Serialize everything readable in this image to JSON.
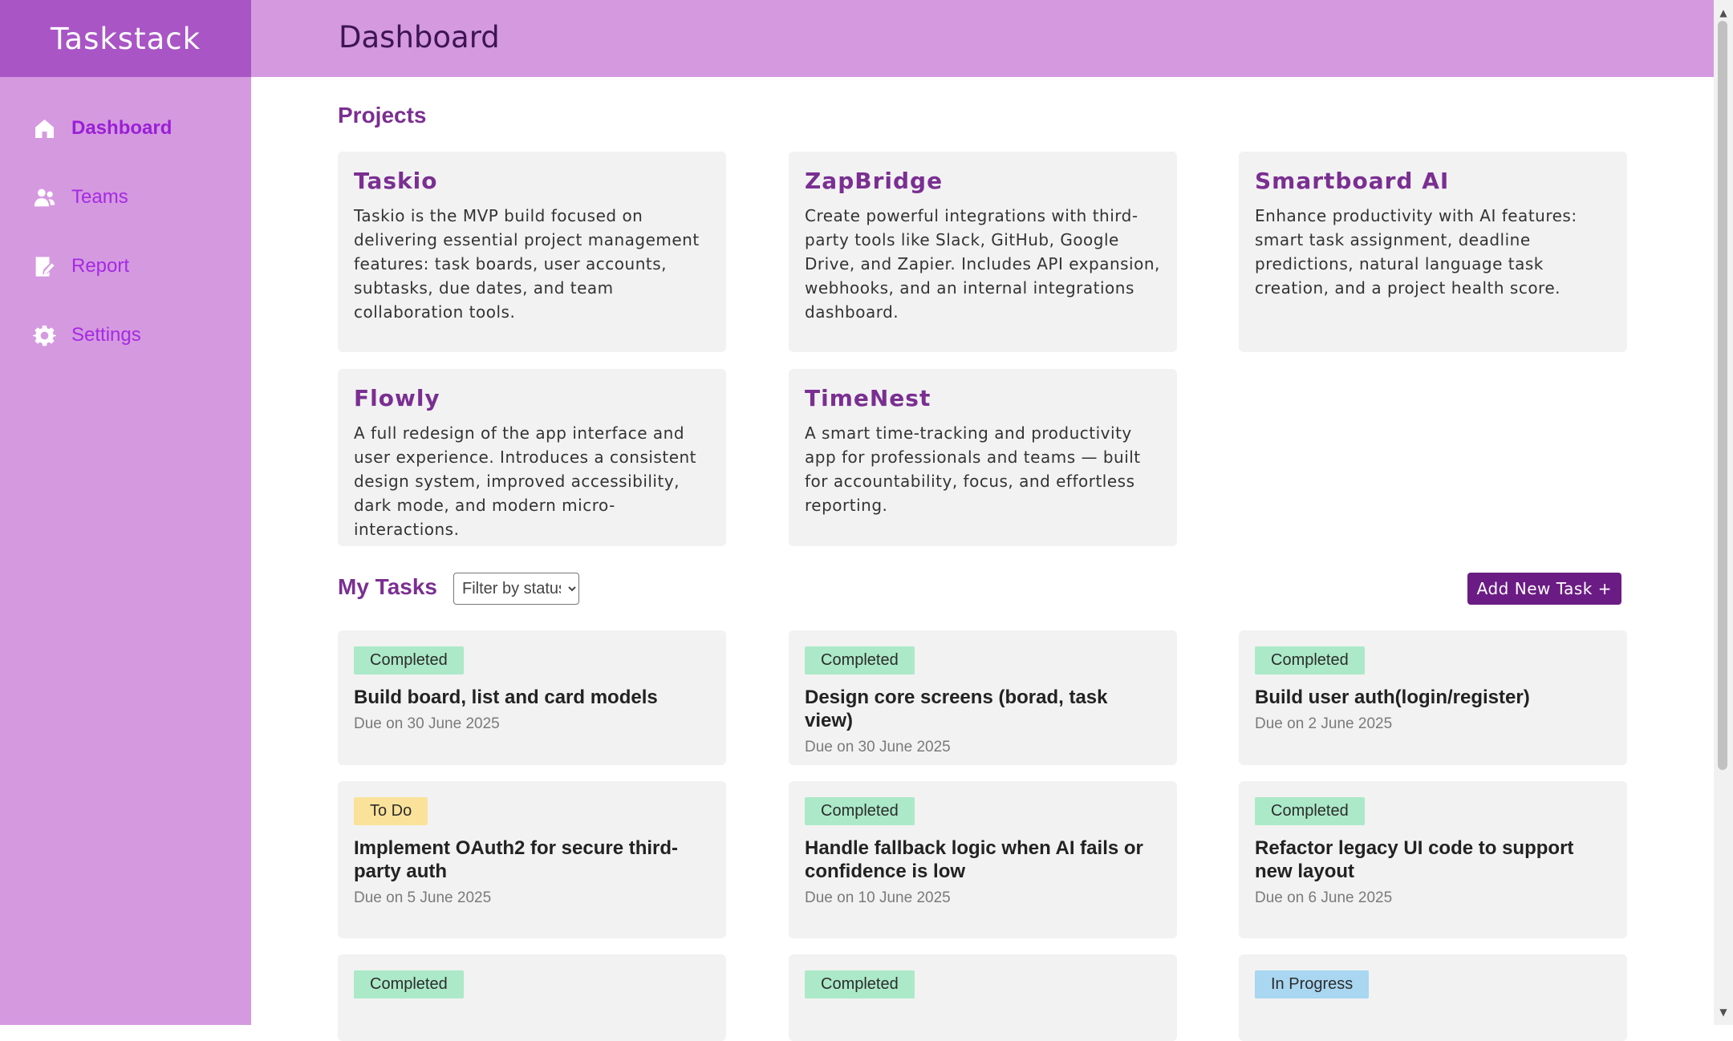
{
  "app": {
    "name": "Taskstack"
  },
  "sidebar": {
    "items": [
      {
        "label": "Dashboard",
        "icon": "home-icon"
      },
      {
        "label": "Teams",
        "icon": "users-icon"
      },
      {
        "label": "Report",
        "icon": "report-icon"
      },
      {
        "label": "Settings",
        "icon": "gear-icon"
      }
    ]
  },
  "header": {
    "title": "Dashboard"
  },
  "projects": {
    "title": "Projects",
    "items": [
      {
        "name": "Taskio",
        "description": "Taskio is the MVP build focused on delivering essential project management features: task boards, user accounts, subtasks, due dates, and team collaboration tools."
      },
      {
        "name": "ZapBridge",
        "description": "Create powerful integrations with third-party tools like Slack, GitHub, Google Drive, and Zapier. Includes API expansion, webhooks, and an internal integrations dashboard."
      },
      {
        "name": "Smartboard AI",
        "description": "Enhance productivity with AI features: smart task assignment, deadline predictions, natural language task creation, and a project health score."
      },
      {
        "name": "Flowly",
        "description": "A full redesign of the app interface and user experience. Introduces a consistent design system, improved accessibility, dark mode, and modern micro-interactions."
      },
      {
        "name": "TimeNest",
        "description": "A smart time-tracking and productivity app for professionals and teams — built for accountability, focus, and effortless reporting."
      }
    ]
  },
  "tasks": {
    "title": "My Tasks",
    "filter_value": "Filter by status",
    "add_button_label": "Add New Task +",
    "items": [
      {
        "status": "Completed",
        "title": "Build board, list and card models",
        "due": "Due on 30 June 2025"
      },
      {
        "status": "Completed",
        "title": "Design core screens (borad, task view)",
        "due": "Due on 30 June 2025"
      },
      {
        "status": "Completed",
        "title": "Build user auth(login/register)",
        "due": "Due on 2 June 2025"
      },
      {
        "status": "To Do",
        "title": "Implement OAuth2 for secure third-party auth",
        "due": "Due on 5 June 2025"
      },
      {
        "status": "Completed",
        "title": "Handle fallback logic when AI fails or confidence is low",
        "due": "Due on 10 June 2025"
      },
      {
        "status": "Completed",
        "title": "Refactor legacy UI code to support new layout",
        "due": "Due on 6 June 2025"
      },
      {
        "status": "Completed"
      },
      {
        "status": "Completed"
      },
      {
        "status": "In Progress"
      }
    ]
  },
  "colors": {
    "sidebar_bg": "#d599e0",
    "logo_bg": "#a955c6",
    "accent": "#7a2f91",
    "button_bg": "#6b1c84",
    "status_completed": "#abe9c8",
    "status_todo": "#fbe29a",
    "status_in_progress": "#a9d6f1"
  }
}
